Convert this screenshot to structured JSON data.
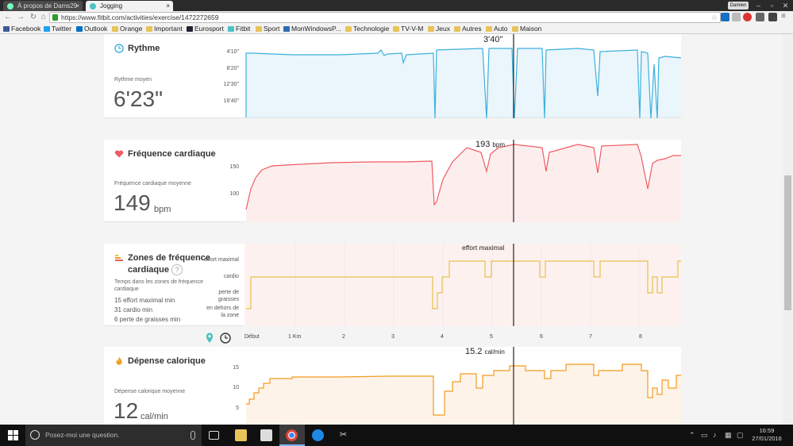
{
  "browser": {
    "tabs": [
      {
        "label": "À propos de Dams29",
        "close": "×"
      },
      {
        "label": "Jogging",
        "close": "×"
      }
    ],
    "window_user": "Damien",
    "url": "https://www.fitbit.com/activities/exercise/1472272659",
    "bookmarks": [
      "Facebook",
      "Twitter",
      "Outlook",
      "Orange",
      "Important",
      "Eurosport",
      "Fitbit",
      "Sport",
      "MonWindowsP...",
      "Technologie",
      "TV-V-M",
      "Jeux",
      "Autres",
      "Auto",
      "Maison"
    ]
  },
  "pace": {
    "title": "Rythme",
    "subtitle": "Rythme moyen",
    "value": "6'23\"",
    "ticks": [
      "4'10\"",
      "8'20\"",
      "12'30\"",
      "16'40\""
    ],
    "readout": "3'40\"",
    "colors": {
      "line": "#3bb0dd",
      "fill": "#eaf5fc"
    }
  },
  "heart": {
    "title": "Fréquence cardiaque",
    "subtitle": "Fréquence cardiaque moyenne",
    "value": "149",
    "unit": "bpm",
    "ticks": [
      "150",
      "100"
    ],
    "readout": "193",
    "readout_unit": "bpm",
    "colors": {
      "line": "#ef5b62",
      "fill": "#fdeeee"
    }
  },
  "zones": {
    "title": "Zones de fréquence cardiaque",
    "help": "?",
    "subtitle": "Temps dans les zones de fréquence cardiaque",
    "stats": [
      "15 effort maximal min",
      "31 cardio min",
      "6 perte de graisses min"
    ],
    "levels": [
      "effort maximal",
      "cardio",
      "perte de graisses",
      "en dehors de la zone"
    ],
    "readout": "effort maximal",
    "colors": {
      "line": "#e8c14a",
      "fill": "#fdf1ef"
    }
  },
  "xaxis": {
    "labels": [
      "Début",
      "1 Km",
      "2",
      "3",
      "4",
      "5",
      "6",
      "7",
      "8"
    ]
  },
  "calories": {
    "title": "Dépense calorique",
    "subtitle": "Dépense calorique moyenne",
    "value": "12",
    "unit": "cal/min",
    "ticks": [
      "15",
      "10",
      "5"
    ],
    "readout": "15.2",
    "readout_unit": "cal/min",
    "colors": {
      "line": "#f39c1f",
      "fill": "#fdf3e8"
    }
  },
  "taskbar": {
    "search_placeholder": "Posez-moi une question.",
    "time": "16:59",
    "date": "27/01/2016"
  }
}
